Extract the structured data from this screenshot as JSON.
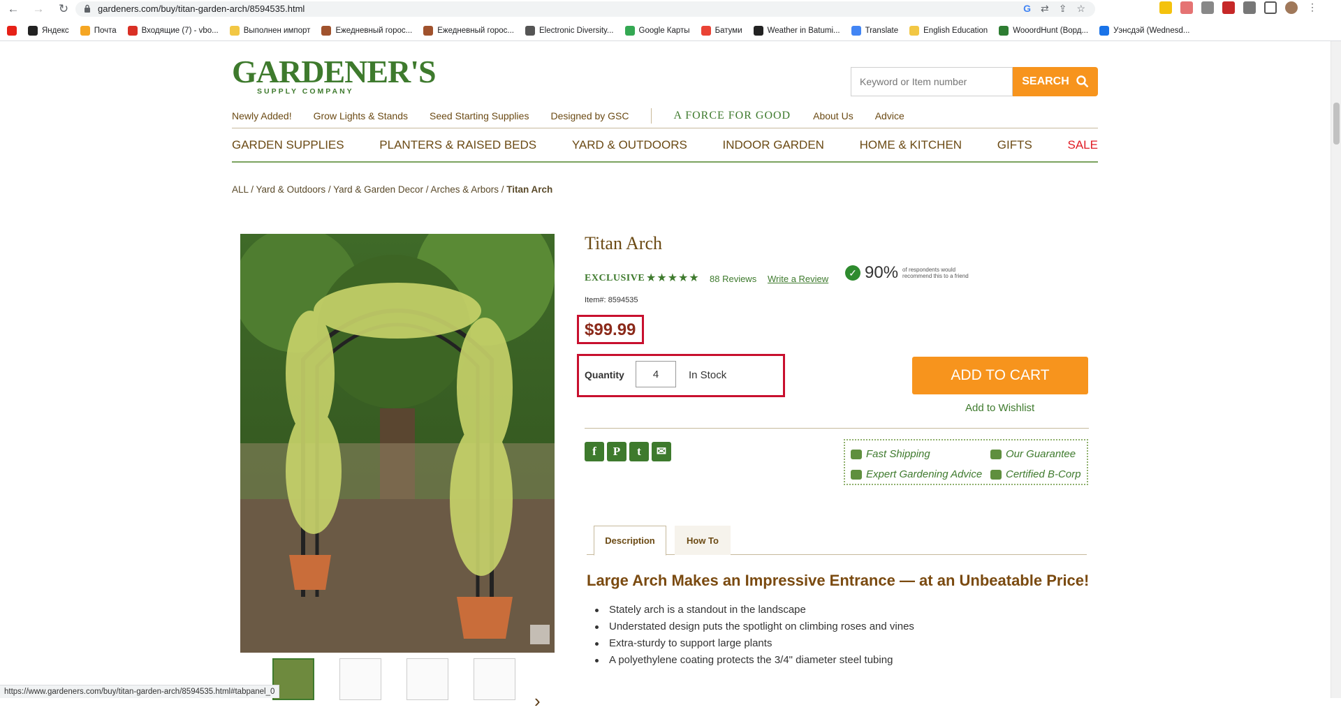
{
  "browser": {
    "url": "gardeners.com/buy/titan-garden-arch/8594535.html",
    "status_url": "https://www.gardeners.com/buy/titan-garden-arch/8594535.html#tabpanel_0",
    "bookmarks": [
      {
        "label": "",
        "color": "#e62117"
      },
      {
        "label": "Яндекс",
        "color": "#222222"
      },
      {
        "label": "Почта",
        "color": "#f5a623"
      },
      {
        "label": "Входящие (7) - vbo...",
        "color": "#d93025"
      },
      {
        "label": "Выполнен импорт",
        "color": "#f2c744"
      },
      {
        "label": "Ежедневный горос...",
        "color": "#a0522d"
      },
      {
        "label": "Ежедневный горос...",
        "color": "#a0522d"
      },
      {
        "label": "Electronic Diversity...",
        "color": "#555555"
      },
      {
        "label": "Google Карты",
        "color": "#34a853"
      },
      {
        "label": "Батуми",
        "color": "#ea4335"
      },
      {
        "label": "Weather in Batumi...",
        "color": "#222222"
      },
      {
        "label": "Translate",
        "color": "#4285f4"
      },
      {
        "label": "English Education",
        "color": "#f2c744"
      },
      {
        "label": "WooordHunt (Ворд...",
        "color": "#2e7d32"
      },
      {
        "label": "Уэнсдэй (Wednesd...",
        "color": "#1a73e8"
      }
    ]
  },
  "site": {
    "logo_main": "GARDENER'S",
    "logo_sub": "SUPPLY COMPANY",
    "search_placeholder": "Keyword or Item number",
    "search_button": "SEARCH",
    "top_links": [
      "Newly Added!",
      "Grow Lights & Stands",
      "Seed Starting Supplies",
      "Designed by GSC"
    ],
    "force_for_good": "A FORCE FOR GOOD",
    "about": "About Us",
    "advice": "Advice",
    "main_nav": [
      "GARDEN SUPPLIES",
      "PLANTERS & RAISED BEDS",
      "YARD & OUTDOORS",
      "INDOOR GARDEN",
      "HOME & KITCHEN",
      "GIFTS",
      "SALE"
    ],
    "breadcrumbs": [
      "ALL",
      "Yard & Outdoors",
      "Yard & Garden Decor",
      "Arches & Arbors"
    ],
    "breadcrumb_current": "Titan Arch"
  },
  "product": {
    "title": "Titan Arch",
    "badge": "EXCLUSIVE",
    "rating": 4.5,
    "stars": "★★★★★",
    "reviews": "88 Reviews",
    "write_review": "Write a Review",
    "recommend_pct": "90%",
    "recommend_note": "of respondents would recommend this to a friend",
    "item_no": "Item#: 8594535",
    "price": "$99.99",
    "qty_label": "Quantity",
    "qty": "4",
    "stock": "In Stock",
    "add_to_cart": "ADD TO CART",
    "wishlist": "Add to Wishlist",
    "perks": [
      "Fast Shipping",
      "Our Guarantee",
      "Expert Gardening Advice",
      "Certified B-Corp"
    ],
    "tabs": [
      "Description",
      "How To"
    ],
    "desc_heading": "Large Arch Makes an Impressive Entrance — at an Unbeatable Price!",
    "bullets": [
      "Stately arch is a standout in the landscape",
      "Understated design puts the spotlight on climbing roses and vines",
      "Extra-sturdy to support large plants",
      "A polyethylene coating protects the 3/4\" diameter steel tubing"
    ]
  }
}
